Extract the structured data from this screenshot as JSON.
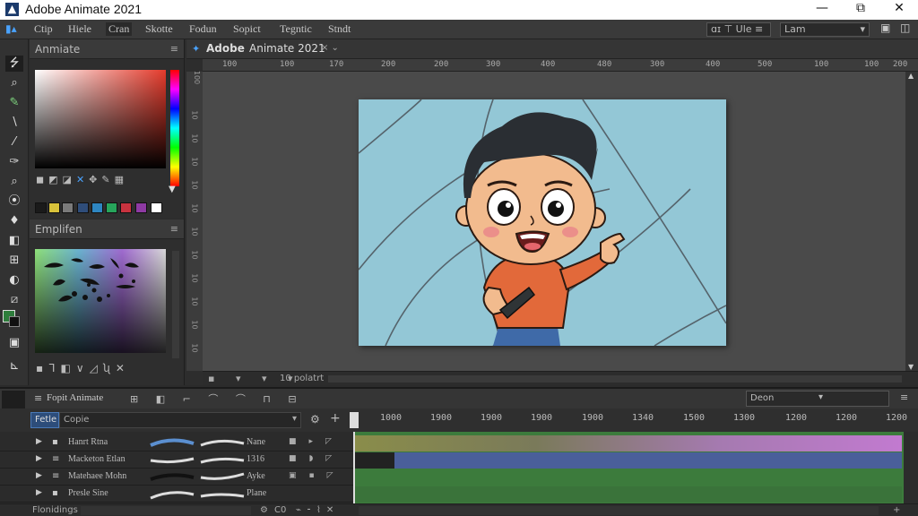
{
  "window": {
    "title": "Adobe Animate 2021",
    "minimize": "—",
    "restore": "⧉",
    "close": "✕"
  },
  "menu": {
    "items": [
      "Ctip",
      "Hiele",
      "Cran",
      "Skotte",
      "Fodun",
      "Sopict",
      "Tegntic",
      "Stndt"
    ]
  },
  "workspace": {
    "button_label": "ɑɪ ⊤ Ule ≡",
    "value": "Lam"
  },
  "toolbar": {
    "tools": [
      "⭍",
      "⌕",
      "✎",
      "∖",
      "⁄",
      "✑",
      "⌕",
      "⦿",
      "♦",
      "◧",
      "⊞",
      "◐",
      "⧄",
      "▣",
      "⊾"
    ]
  },
  "color_panel": {
    "title": "Anmiate",
    "swatches": [
      "#1a1a1a",
      "#d8c23a",
      "#7a7a7a",
      "#2f4d7a",
      "#2e86c1",
      "#27a55b",
      "#c8333f",
      "#8e3aa3",
      "#ffffff"
    ]
  },
  "style_panel": {
    "title": "Emplifen"
  },
  "document": {
    "tab_icon": "✦",
    "app_label": "Adobe",
    "tab_label": "Animate 2021",
    "tab_close": "× ⌄"
  },
  "ruler": {
    "ticks": [
      "100",
      "100",
      "170",
      "200",
      "200",
      "300",
      "400",
      "480",
      "300",
      "400",
      "500",
      "100",
      "100",
      "200"
    ]
  },
  "ruler_v": {
    "ticks": [
      "100",
      "10",
      "10",
      "10",
      "10",
      "10",
      "10",
      "10",
      "10",
      "10",
      "10",
      "10",
      "10"
    ]
  },
  "stage_bar": {
    "label": "10 polatrt"
  },
  "timeline": {
    "title": "Fopit Animate",
    "select_value": "Deon",
    "filter_label": "Fetle",
    "filter_value": "Copie",
    "frame_numbers": [
      "1000",
      "1900",
      "1900",
      "1900",
      "1900",
      "1340",
      "1500",
      "1300",
      "1200",
      "1200",
      "1200"
    ],
    "layers": [
      {
        "name": "Hanrt Rtna",
        "right": "Nane"
      },
      {
        "name": "Macketon Etlan",
        "right": "1316"
      },
      {
        "name": "Matehaee Mohn",
        "right": "Ayke"
      },
      {
        "name": "Presle Sine",
        "right": "Plane"
      }
    ]
  },
  "footer": {
    "left": "Flonidings",
    "zoom": "C0",
    "plus": "+"
  }
}
